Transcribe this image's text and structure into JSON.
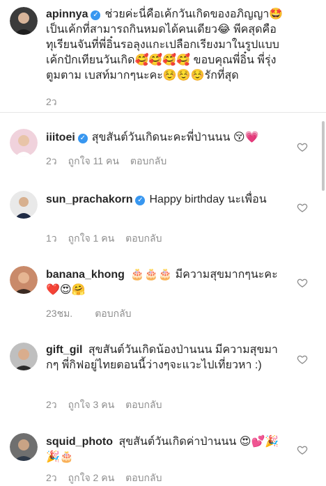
{
  "caption": {
    "username": "apinnya",
    "text": "ช่วยค่ะนี่คือเค้กวันเกิดของอภิญญา🤩 เป็นเค้กที่สามารถกินหมดได้คนเดียว😂 พีคสุดคือทุเรียนจันที่พี่อิ๋นรอลุงแกะเปลือกเรียงมาในรูปแบบเค้กปักเทียนวันเกิด🥰🥰🥰🥰 ขอบคุณพี่อิ๋น พี่รุ่ง ตูมตาม เบสท์มากๆนะคะ☺️☺️☺️รักที่สุด",
    "time": "2ว"
  },
  "comments": [
    {
      "username": "iiitoei",
      "verified": true,
      "text": "สุขสันต์วันเกิดนะคะพี่ป่านนน 😚💗",
      "time": "2ว",
      "likes": "ถูกใจ 11 คน",
      "reply": "ตอบกลับ"
    },
    {
      "username": "sun_prachakorn",
      "verified": true,
      "text": "Happy birthday นะเพื่อน",
      "time": "1ว",
      "likes": "ถูกใจ 1 คน",
      "reply": "ตอบกลับ"
    },
    {
      "username": "banana_khong",
      "verified": false,
      "text": "🎂🎂🎂 มีความสุขมากๆนะคะ❤️😍🤗",
      "time": "23ชม.",
      "likes": "",
      "reply": "ตอบกลับ"
    },
    {
      "username": "gift_gil",
      "verified": false,
      "text": "สุขสันต์วันเกิดน้องป่านนน มีความสุขมากๆ พี่กิฟอยู่ไทยตอนนี้ว่างๆจะแวะไปเที่ยวหา :)",
      "time": "2ว",
      "likes": "ถูกใจ 3 คน",
      "reply": "ตอบกลับ"
    },
    {
      "username": "squid_photo",
      "verified": false,
      "text": "สุขสันต์วันเกิดค่าป่านนน 😍💕🎉🎉🎂",
      "time": "2ว",
      "likes": "ถูกใจ 2 คน",
      "reply": "ตอบกลับ"
    }
  ],
  "colors": {
    "verified": "#3897f0",
    "meta": "#8e8e8e",
    "text": "#262626"
  }
}
